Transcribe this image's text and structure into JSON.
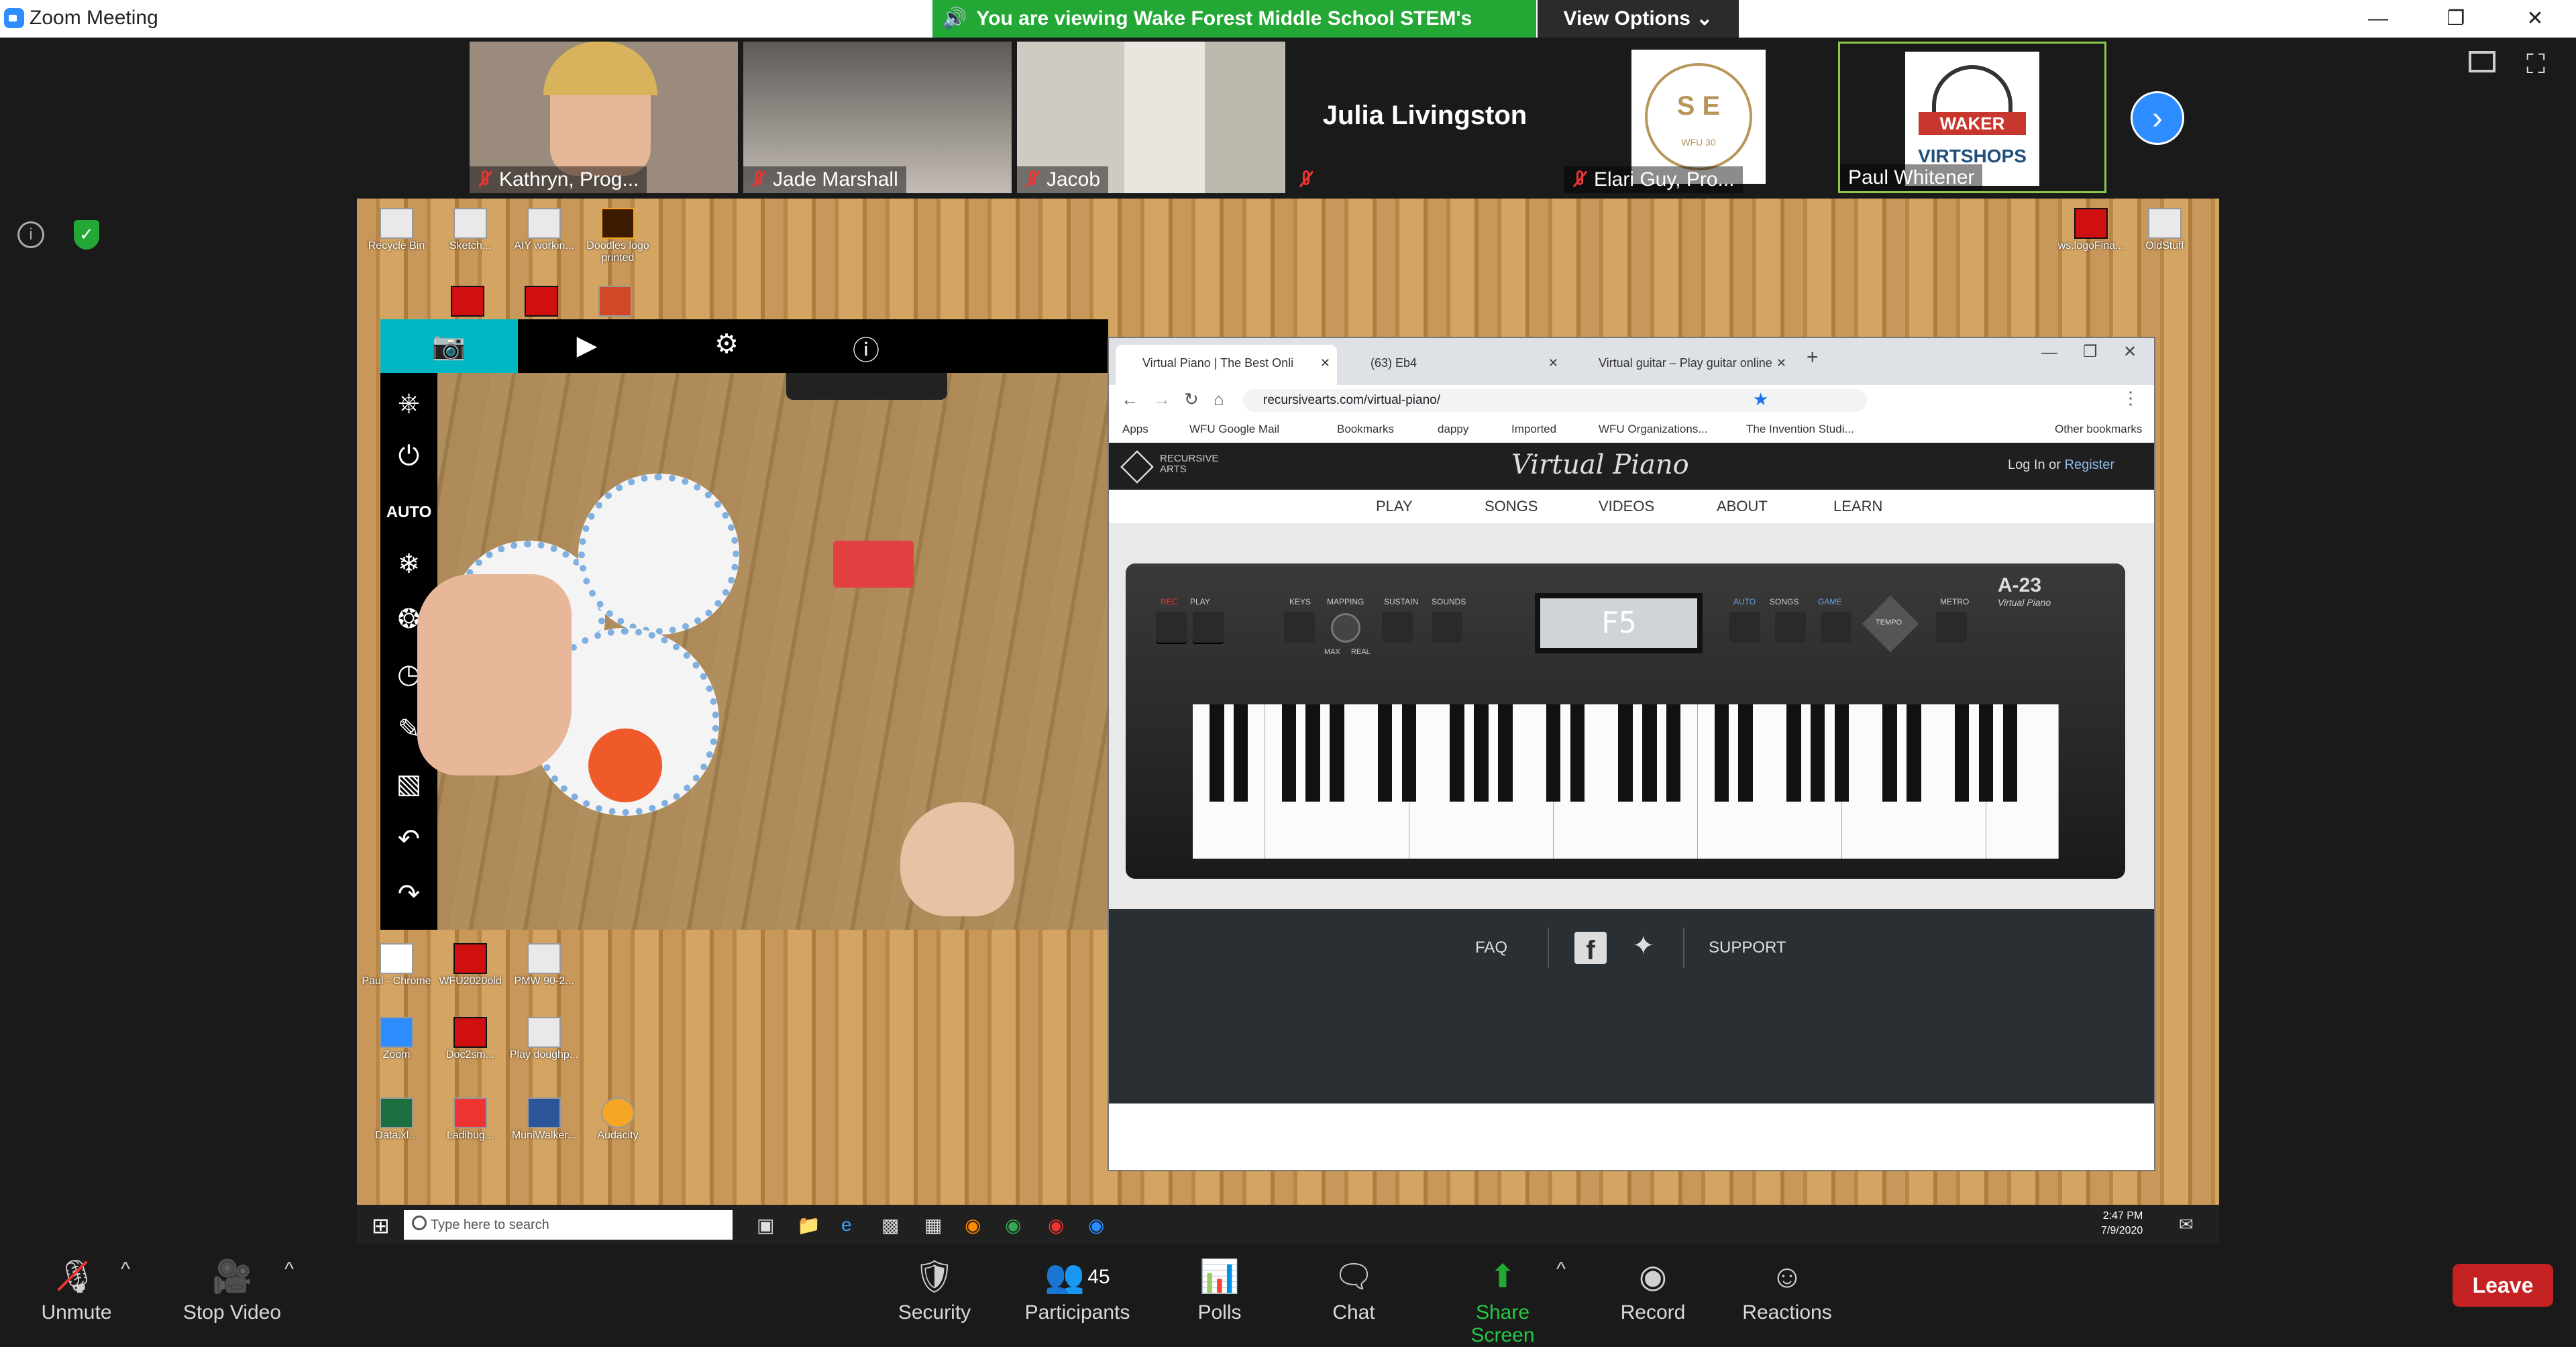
{
  "window": {
    "title": "Zoom Meeting",
    "minimize": "—",
    "restore": "❐",
    "close": "✕"
  },
  "share_banner": {
    "text": "You are viewing Wake Forest Middle School STEM's screen",
    "view_options": "View Options ⌄"
  },
  "participants_strip": [
    {
      "name": "Kathryn, Prog...",
      "muted": true
    },
    {
      "name": "Jade Marshall",
      "muted": true
    },
    {
      "name": "Jacob",
      "muted": true
    },
    {
      "name": "Julia Livingston",
      "muted": true
    },
    {
      "name": "Elari Guy, Pro...",
      "muted": true
    },
    {
      "name": "Paul Whitener",
      "muted": false
    }
  ],
  "logos": {
    "wfu": {
      "letters": "S  E",
      "sub": "WFU 30"
    },
    "waker": {
      "top": "WAKER",
      "bottom": "VIRTSHOPS"
    }
  },
  "desktop_icons": [
    {
      "label": "Recycle Bin"
    },
    {
      "label": "Sketch..."
    },
    {
      "label": "AIY workin..."
    },
    {
      "label": "Doodles logo printed"
    },
    {
      "label": "ws.logoFina..."
    },
    {
      "label": "OldStuff"
    },
    {
      "label": "Paul - Chrome"
    },
    {
      "label": "WFU2020old"
    },
    {
      "label": "PMW 90-2..."
    },
    {
      "label": "Zoom"
    },
    {
      "label": "Doc2sm..."
    },
    {
      "label": "Play doughp..."
    },
    {
      "label": "Data.xl..."
    },
    {
      "label": "Ladibug..."
    },
    {
      "label": "MuniWalker..."
    },
    {
      "label": "Audacity"
    }
  ],
  "camera_app": {
    "side_labels": {
      "auto": "AUTO"
    }
  },
  "browser": {
    "tabs": [
      {
        "title": "Virtual Piano | The Best Onli",
        "active": true
      },
      {
        "title": "(63) Eb4",
        "active": false
      },
      {
        "title": "Virtual guitar – Play guitar online",
        "active": false
      }
    ],
    "new_tab": "+",
    "url": "recursivearts.com/virtual-piano/",
    "bookmarks": [
      "Apps",
      "WFU Google Mail",
      "Bookmarks",
      "dappy",
      "Imported",
      "WFU Organizations...",
      "The Invention Studi..."
    ],
    "other_bookmarks": "Other bookmarks"
  },
  "site": {
    "brand": "RECURSIVE ARTS",
    "title": "Virtual Piano",
    "login": "Log In",
    "or": "or",
    "register": "Register",
    "nav": [
      "PLAY",
      "SONGS",
      "VIDEOS",
      "ABOUT",
      "LEARN"
    ],
    "piano": {
      "model": "A-23",
      "model_sub": "Virtual Piano",
      "display": "F5",
      "labels": [
        "REC",
        "PLAY",
        "KEYS",
        "MAPPING",
        "SUSTAIN",
        "SOUNDS",
        "AUTO",
        "SONGS",
        "GAME",
        "TEMPO",
        "METRO"
      ],
      "mapping_sub": [
        "MAX",
        "REAL"
      ]
    },
    "footer": {
      "faq": "FAQ",
      "support": "SUPPORT"
    }
  },
  "taskbar": {
    "search_placeholder": "Type here to search",
    "time": "2:47 PM",
    "date": "7/9/2020"
  },
  "zoom_controls": {
    "unmute": "Unmute",
    "stop_video": "Stop Video",
    "security": "Security",
    "participants": "Participants",
    "participants_count": "45",
    "polls": "Polls",
    "chat": "Chat",
    "share_screen": "Share Screen",
    "record": "Record",
    "reactions": "Reactions",
    "leave": "Leave"
  },
  "colors": {
    "zoom_blue": "#2d8cff",
    "share_green": "#24a835",
    "leave_red": "#c42222",
    "camera_accent": "#00b7c3"
  }
}
